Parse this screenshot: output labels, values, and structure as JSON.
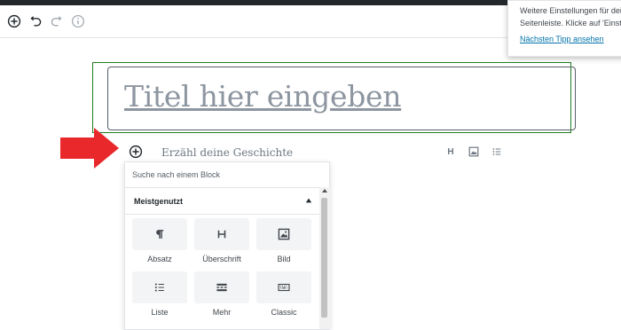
{
  "colors": {
    "accent": "#0073aa",
    "outline": "#1e7e1e",
    "arrow": "#e8282b",
    "text": "#555d66"
  },
  "toolbar": {
    "buttons": [
      {
        "icon": "add-block-icon",
        "label": ""
      },
      {
        "icon": "undo-icon",
        "label": ""
      },
      {
        "icon": "redo-icon",
        "label": ""
      },
      {
        "icon": "info-icon",
        "label": ""
      }
    ]
  },
  "tip": {
    "line1": "Weitere Einstellungen für dein",
    "line2": "Seitenleiste. Klicke auf 'Einstell",
    "link": "Nächsten Tipp ansehen"
  },
  "editor": {
    "title_placeholder": "Titel hier eingeben",
    "paragraph_placeholder": "Erzähl deine Geschichte"
  },
  "inserter": {
    "search_placeholder": "Suche nach einem Block",
    "section_label": "Meistgenutzt",
    "blocks": [
      {
        "label": "Absatz",
        "icon": "paragraph-icon"
      },
      {
        "label": "Überschrift",
        "icon": "heading-icon"
      },
      {
        "label": "Bild",
        "icon": "image-icon"
      },
      {
        "label": "Liste",
        "icon": "list-icon"
      },
      {
        "label": "Mehr",
        "icon": "more-icon"
      },
      {
        "label": "Classic",
        "icon": "keyboard-icon"
      }
    ]
  },
  "quick_inserter": [
    {
      "icon": "heading-icon",
      "glyph": "H"
    },
    {
      "icon": "image-icon"
    },
    {
      "icon": "list-icon"
    }
  ]
}
